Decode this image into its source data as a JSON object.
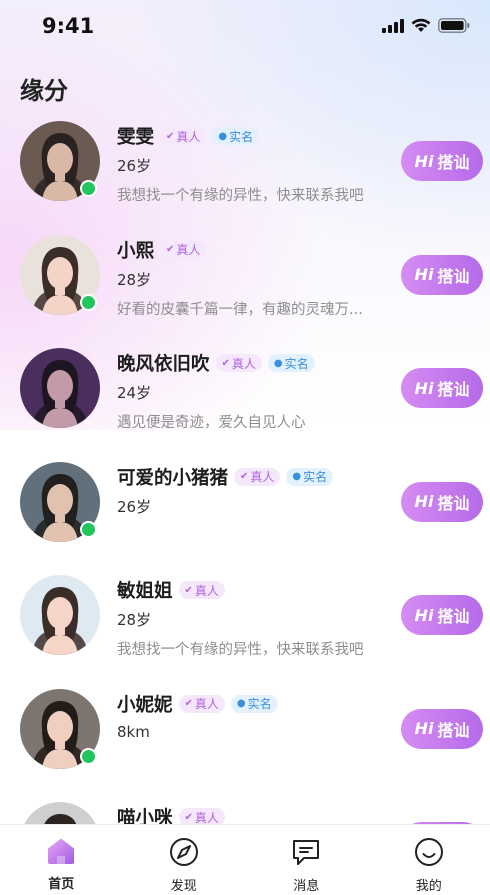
{
  "status_bar": {
    "time": "9:41"
  },
  "page": {
    "title": "缘分"
  },
  "badges": {
    "real": "真人",
    "verified": "实名"
  },
  "greet": {
    "hi": "Hi",
    "label": "搭讪"
  },
  "colors": {
    "accent": "#c47bee",
    "online": "#22c55e"
  },
  "users": [
    {
      "name": "雯雯",
      "real": true,
      "verified": true,
      "meta": "26岁",
      "bio": "我想找一个有缘的异性，快来联系我吧",
      "online": true
    },
    {
      "name": "小熙",
      "real": true,
      "verified": false,
      "meta": "28岁",
      "bio": "好看的皮囊千篇一律，有趣的灵魂万...",
      "online": true
    },
    {
      "name": "晚风依旧吹",
      "real": true,
      "verified": true,
      "meta": "24岁",
      "bio": "遇见便是奇迹，爱久自见人心",
      "online": false
    },
    {
      "name": "可爱的小猪猪",
      "real": true,
      "verified": true,
      "meta": "26岁",
      "bio": "",
      "online": true
    },
    {
      "name": "敏姐姐",
      "real": true,
      "verified": false,
      "meta": "28岁",
      "bio": "我想找一个有缘的异性，快来联系我吧",
      "online": false
    },
    {
      "name": "小妮妮",
      "real": true,
      "verified": true,
      "meta": "8km",
      "bio": "",
      "online": true
    },
    {
      "name": "喵小咪",
      "real": true,
      "verified": false,
      "meta": "",
      "bio": "",
      "online": false
    }
  ],
  "tabs": [
    {
      "label": "首页",
      "icon": "home-icon",
      "active": true
    },
    {
      "label": "发现",
      "icon": "compass-icon",
      "active": false
    },
    {
      "label": "消息",
      "icon": "message-icon",
      "active": false
    },
    {
      "label": "我的",
      "icon": "smile-icon",
      "active": false
    }
  ]
}
